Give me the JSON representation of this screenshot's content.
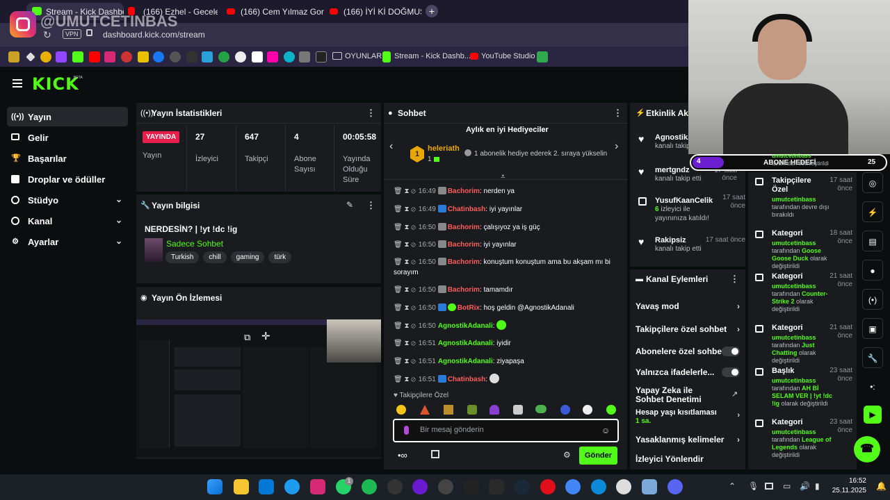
{
  "browser": {
    "tabs": [
      {
        "label": "Stream - Kick Dashboard",
        "active": true
      },
      {
        "label": "(166) Ezhel - Geceler"
      },
      {
        "label": "(166) Cem Yılmaz Gora/Ar"
      },
      {
        "label": "(166) İYİ Kİ DOĞMUŞUM K"
      }
    ],
    "new_tab": "+",
    "vpn": "VPN",
    "url": "dashboard.kick.com/stream",
    "bookmarks": [
      {
        "label": "OYUNLAR"
      },
      {
        "label": "Stream - Kick Dashb..."
      },
      {
        "label": "YouTube Studio"
      }
    ]
  },
  "watermark": "@UMUTCETINBAS",
  "kick": {
    "logo": "KICK",
    "beta": "BETA"
  },
  "sidebar": {
    "items": [
      {
        "label": "Yayın",
        "icon": "broadcast-icon"
      },
      {
        "label": "Gelir",
        "icon": "wallet-icon"
      },
      {
        "label": "Başarılar",
        "icon": "trophy-icon"
      },
      {
        "label": "Droplar ve ödüller",
        "icon": "gift-icon"
      },
      {
        "label": "Stüdyo",
        "icon": "studio-icon"
      },
      {
        "label": "Kanal",
        "icon": "channel-icon"
      },
      {
        "label": "Ayarlar",
        "icon": "settings-icon"
      }
    ]
  },
  "stats": {
    "title": "Yayın İstatistikleri",
    "live_badge": "YAYINDA",
    "live_label": "Yayın",
    "items": [
      {
        "value": "27",
        "label": "İzleyici"
      },
      {
        "value": "647",
        "label": "Takipçi"
      },
      {
        "value": "4",
        "label": "Abone Sayısı"
      },
      {
        "value": "00:05:58",
        "label": "Yayında Olduğu Süre"
      }
    ]
  },
  "stream_info": {
    "title": "Yayın bilgisi",
    "stream_title": "NERDESİN? | !yt !dc !ig",
    "category": "Sadece Sohbet",
    "tags": [
      "Turkish",
      "chill",
      "gaming",
      "türk"
    ]
  },
  "preview": {
    "title": "Yayın Ön İzlemesi"
  },
  "chat": {
    "title": "Sohbet",
    "gifters_title": "Aylık en iyi Hediyeciler",
    "top_gifter": {
      "rank": "1",
      "name": "heleriath",
      "count": "1",
      "message": "1 abonelik hediye ederek 2. sıraya yükselin"
    },
    "messages": [
      {
        "time": "16:49",
        "user": "Bachorim",
        "color": "red",
        "text": "nerden ya"
      },
      {
        "time": "16:49",
        "user": "Chatinbash",
        "color": "red",
        "text": "iyi yayınlar"
      },
      {
        "time": "16:50",
        "user": "Bachorim",
        "color": "red",
        "text": "çalışıyoz ya iş güç"
      },
      {
        "time": "16:50",
        "user": "Bachorim",
        "color": "red",
        "text": "iyi yayınlar"
      },
      {
        "time": "16:50",
        "user": "Bachorim",
        "color": "red",
        "text": "konuştum konuştum ama bu akşam mı bi sorayım"
      },
      {
        "time": "16:50",
        "user": "Bachorim",
        "color": "red",
        "text": "tamamdır"
      },
      {
        "time": "16:50",
        "user": "BotRix",
        "color": "red",
        "text": "hoş geldin @AgnostikAdanali"
      },
      {
        "time": "16:50",
        "user": "AgnostikAdanali",
        "color": "green",
        "text": ""
      },
      {
        "time": "16:51",
        "user": "AgnostikAdanali",
        "color": "green",
        "text": "iyidir"
      },
      {
        "time": "16:51",
        "user": "AgnostikAdanali",
        "color": "green",
        "text": "ziyapaşa"
      },
      {
        "time": "16:51",
        "user": "Chatinbash",
        "color": "red",
        "text": ""
      }
    ],
    "emote_section": "Takipçilere Özel",
    "input_placeholder": "Bir mesaj gönderin",
    "send_label": "Gönder"
  },
  "activity": {
    "title": "Etkinlik Akışı",
    "items": [
      {
        "name": "AgnostikA",
        "desc": "kanalı takip etti",
        "time": ""
      },
      {
        "name": "mertgndz",
        "desc": "kanalı takip etti",
        "time": "17 saat önce"
      },
      {
        "name": "YusufKaanCelik",
        "desc_count": "6",
        "desc": "izleyici ile yayınınıza katıldı!",
        "time": "17 saat önce"
      },
      {
        "name": "Rakipsiz",
        "desc": "kanalı takip etti",
        "time": "17 saat önce"
      }
    ]
  },
  "channel_actions": {
    "title": "Kanal Eylemleri",
    "items": [
      {
        "label": "Yavaş mod"
      },
      {
        "label": "Takipçilere özel sohbet"
      },
      {
        "label": "Abonelere özel sohbet"
      },
      {
        "label": "Yalnızca ifadelerle..."
      },
      {
        "label": "Yapay Zeka ile Sohbet Denetimi"
      },
      {
        "label": "Hesap yaşı kısıtlaması",
        "sub": "1 sa."
      },
      {
        "label": "Yasaklanmış kelimeler"
      },
      {
        "label": "İzleyici Yönlendir"
      }
    ]
  },
  "sub_goal": {
    "current": "4",
    "label": "ABONE HEDEFİ",
    "target": "25",
    "progress": 0.16,
    "overlay_user": "umutcetinbass",
    "overlay_text": "tarafından etkinleştirildi"
  },
  "mod_log": [
    {
      "title": "Takipçilere Özel",
      "time": "17 saat önce",
      "user": "umutcetinbass",
      "text": "tarafından devre dışı bırakıldı"
    },
    {
      "title": "Kategori",
      "time": "18 saat önce",
      "user": "umutcetinbass",
      "pre": "tarafından",
      "value": "Goose Goose Duck",
      "post": "olarak değiştirildi"
    },
    {
      "title": "Kategori",
      "time": "21 saat önce",
      "user": "umutcetinbass",
      "pre": "tarafından",
      "value": "Counter-Strike 2",
      "post": "olarak değiştirildi"
    },
    {
      "title": "Kategori",
      "time": "21 saat önce",
      "user": "umutcetinbass",
      "pre": "tarafından",
      "value": "Just Chatting",
      "post": "olarak değiştirildi"
    },
    {
      "title": "Başlık",
      "time": "23 saat önce",
      "user": "umutcetinbass",
      "pre": "tarafından",
      "value": "AH Bİ SELAM VER | !yt !dc !ig",
      "post": "olarak değiştirildi"
    },
    {
      "title": "Kategori",
      "time": "23 saat önce",
      "user": "umutcetinbass",
      "pre": "tarafından",
      "value": "League of Legends",
      "post": "olarak değiştirildi"
    }
  ],
  "taskbar": {
    "time": "16:52",
    "date": "25.11.2025",
    "whatsapp_badge": "1"
  },
  "colors": {
    "kick_green": "#53fc18",
    "live_red": "#e91e4c",
    "panel_bg": "#191b1f",
    "page_bg": "#0b0e0f"
  }
}
